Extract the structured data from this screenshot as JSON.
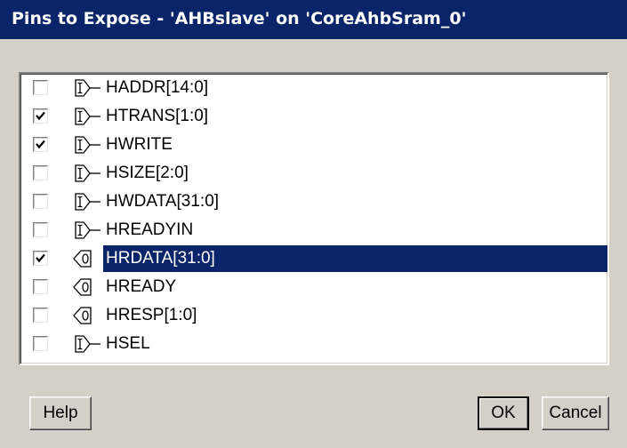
{
  "window": {
    "title": "Pins to Expose - 'AHBslave' on 'CoreAhbSram_0'"
  },
  "pins": [
    {
      "label": "HADDR[14:0]",
      "direction": "input",
      "checked": false,
      "selected": false
    },
    {
      "label": "HTRANS[1:0]",
      "direction": "input",
      "checked": true,
      "selected": false
    },
    {
      "label": "HWRITE",
      "direction": "input",
      "checked": true,
      "selected": false
    },
    {
      "label": "HSIZE[2:0]",
      "direction": "input",
      "checked": false,
      "selected": false
    },
    {
      "label": "HWDATA[31:0]",
      "direction": "input",
      "checked": false,
      "selected": false
    },
    {
      "label": "HREADYIN",
      "direction": "input",
      "checked": false,
      "selected": false
    },
    {
      "label": "HRDATA[31:0]",
      "direction": "output",
      "checked": true,
      "selected": true
    },
    {
      "label": "HREADY",
      "direction": "output",
      "checked": false,
      "selected": false
    },
    {
      "label": "HRESP[1:0]",
      "direction": "output",
      "checked": false,
      "selected": false
    },
    {
      "label": "HSEL",
      "direction": "input",
      "checked": false,
      "selected": false
    }
  ],
  "buttons": {
    "help": "Help",
    "ok": "OK",
    "cancel": "Cancel"
  },
  "icons": {
    "input_pin": "input-pin-icon",
    "output_pin": "output-pin-icon",
    "check": "checkmark-icon"
  },
  "colors": {
    "titlebar": "#0a246a",
    "selection": "#0a246a",
    "face": "#d4d0c8"
  }
}
